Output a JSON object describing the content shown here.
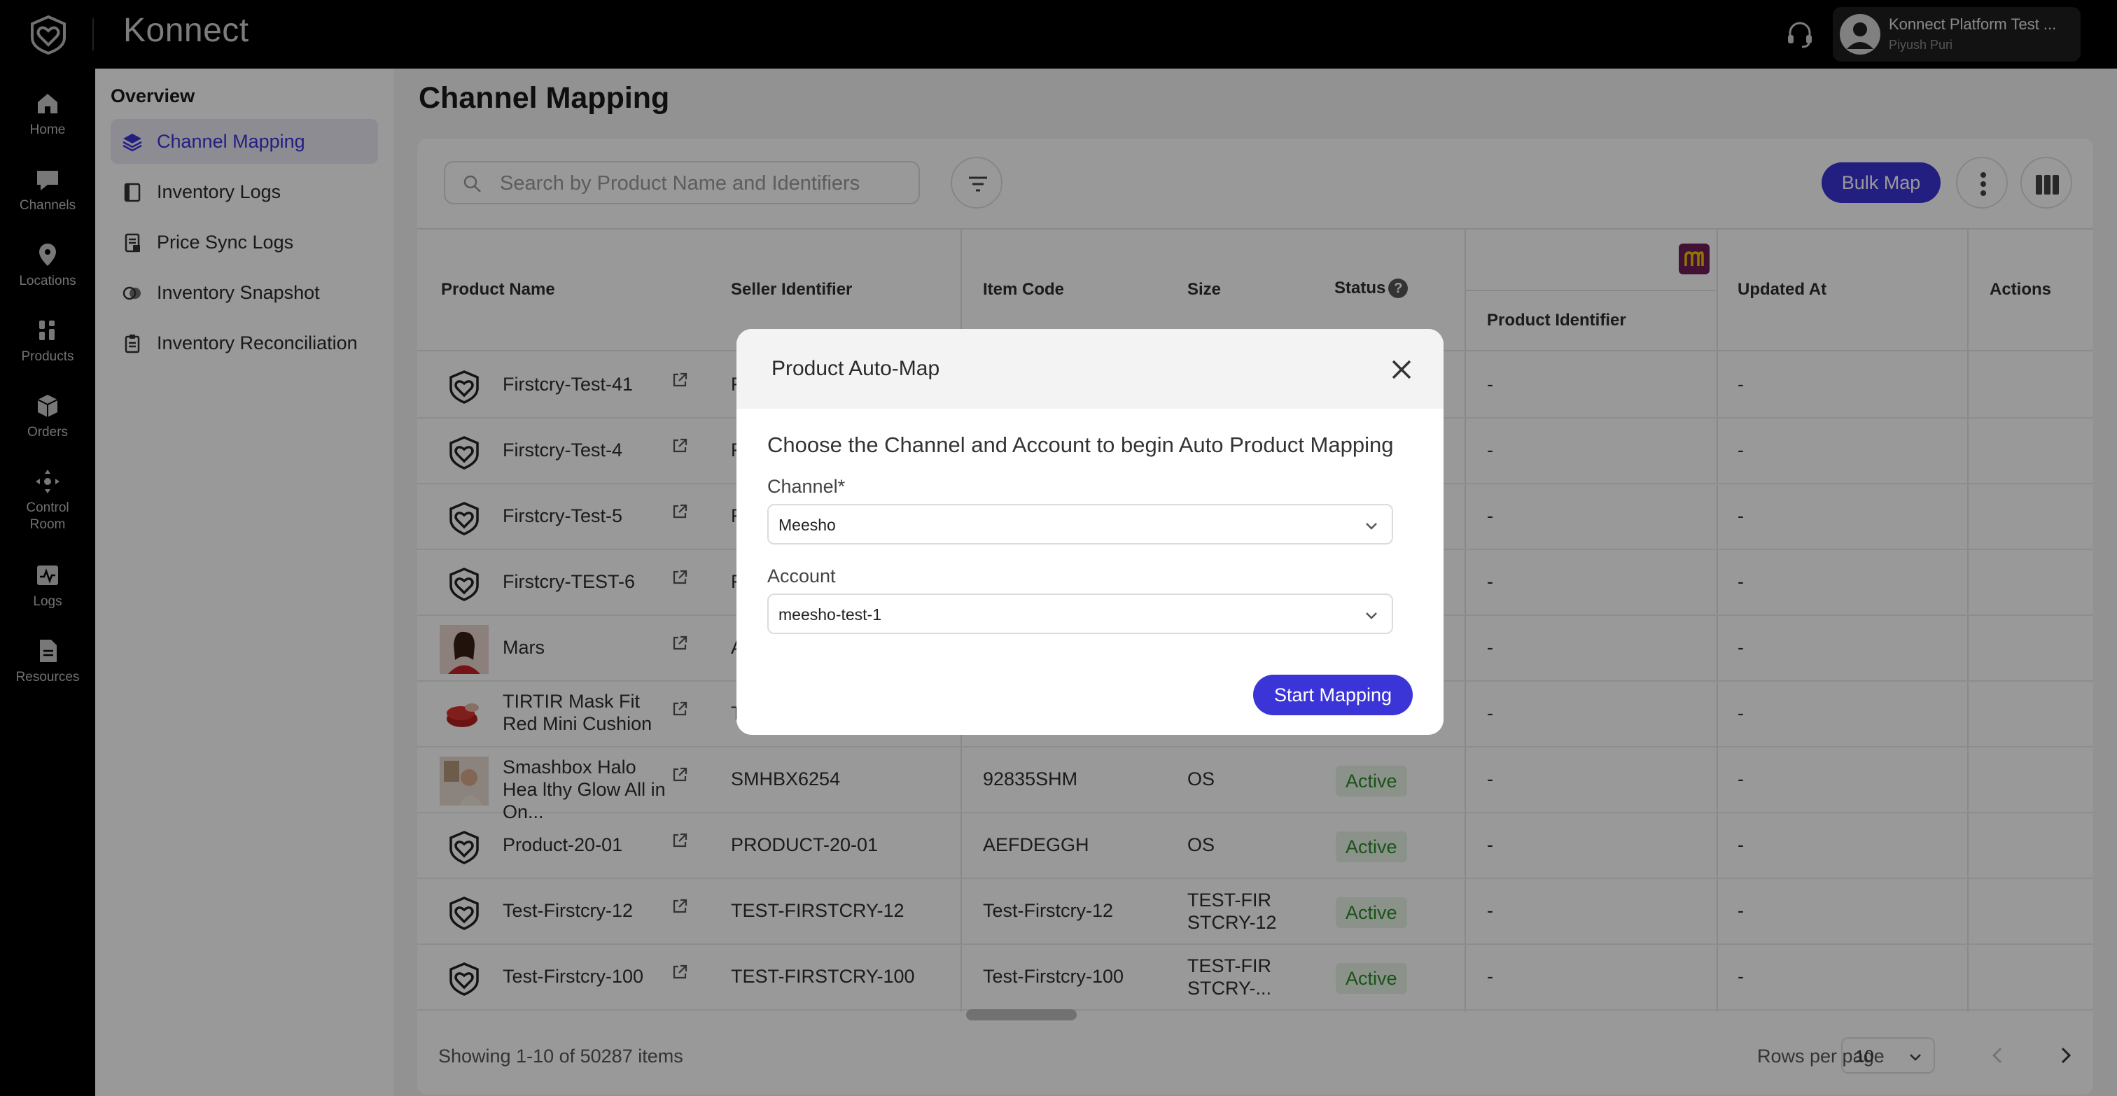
{
  "app": {
    "brand": "Konnect",
    "user_name": "Konnect Platform Test ...",
    "user_sub": "Piyush Puri"
  },
  "rail": {
    "items": [
      {
        "label": "Home",
        "icon": "home-icon"
      },
      {
        "label": "Channels",
        "icon": "channels-icon"
      },
      {
        "label": "Locations",
        "icon": "location-pin-icon"
      },
      {
        "label": "Products",
        "icon": "products-icon"
      },
      {
        "label": "Orders",
        "icon": "orders-box-icon"
      },
      {
        "label": "Control Room",
        "icon": "control-room-icon"
      },
      {
        "label": "Logs",
        "icon": "logs-icon"
      },
      {
        "label": "Resources",
        "icon": "resources-icon"
      }
    ]
  },
  "sidebar": {
    "title": "Overview",
    "items": [
      {
        "label": "Channel Mapping",
        "icon": "layers-icon",
        "active": true
      },
      {
        "label": "Inventory Logs",
        "icon": "book-icon"
      },
      {
        "label": "Price Sync Logs",
        "icon": "receipt-icon"
      },
      {
        "label": "Inventory Snapshot",
        "icon": "snapshot-icon"
      },
      {
        "label": "Inventory Reconciliation",
        "icon": "clipboard-icon"
      }
    ]
  },
  "page": {
    "title": "Channel Mapping",
    "search_placeholder": "Search by Product Name and Identifiers",
    "bulk_map_label": "Bulk Map"
  },
  "table": {
    "headers": {
      "product_name": "Product Name",
      "seller_identifier": "Seller Identifier",
      "item_code": "Item Code",
      "size": "Size",
      "status": "Status",
      "status_help": "?",
      "product_identifier": "Product Identifier",
      "updated_at": "Updated At",
      "actions": "Actions"
    },
    "rows": [
      {
        "name": "Firstcry-Test-41",
        "seller": "F",
        "item": "",
        "size": "",
        "status": "",
        "pid": "-",
        "updated": "-",
        "thumb": "logo"
      },
      {
        "name": "Firstcry-Test-4",
        "seller": "F",
        "item": "",
        "size": "",
        "status": "",
        "pid": "-",
        "updated": "-",
        "thumb": "logo"
      },
      {
        "name": "Firstcry-Test-5",
        "seller": "F",
        "item": "",
        "size": "",
        "status": "",
        "pid": "-",
        "updated": "-",
        "thumb": "logo"
      },
      {
        "name": "Firstcry-TEST-6",
        "seller": "F",
        "item": "",
        "size": "",
        "status": "",
        "pid": "-",
        "updated": "-",
        "thumb": "logo"
      },
      {
        "name": "Mars",
        "seller": "A",
        "item": "",
        "size": "",
        "status": "",
        "pid": "-",
        "updated": "-",
        "thumb": "photo-person"
      },
      {
        "name": "TIRTIR Mask Fit Red Mini Cushion",
        "seller": "T",
        "item": "",
        "size": "",
        "status": "",
        "pid": "-",
        "updated": "-",
        "thumb": "photo-cushion"
      },
      {
        "name": "Smashbox Halo Hea lthy Glow All in On...",
        "seller": "SMHBX6254",
        "item": "92835SHM",
        "size": "OS",
        "status": "Active",
        "pid": "-",
        "updated": "-",
        "thumb": "photo-model"
      },
      {
        "name": "Product-20-01",
        "seller": "PRODUCT-20-01",
        "item": "AEFDEGGH",
        "size": "OS",
        "status": "Active",
        "pid": "-",
        "updated": "-",
        "thumb": "logo"
      },
      {
        "name": "Test-Firstcry-12",
        "seller": "TEST-FIRSTCRY-12",
        "item": "Test-Firstcry-12",
        "size": "TEST-FIR STCRY-12",
        "status": "Active",
        "pid": "-",
        "updated": "-",
        "thumb": "logo"
      },
      {
        "name": "Test-Firstcry-100",
        "seller": "TEST-FIRSTCRY-100",
        "item": "Test-Firstcry-100",
        "size": "TEST-FIR STCRY-...",
        "status": "Active",
        "pid": "-",
        "updated": "-",
        "thumb": "logo"
      }
    ]
  },
  "footer": {
    "showing": "Showing 1-10 of 50287 items",
    "rows_per_page_label": "Rows per page",
    "rows_per_page_value": "10"
  },
  "modal": {
    "title": "Product Auto-Map",
    "description": "Choose the Channel and Account to begin Auto Product Mapping",
    "channel_label": "Channel*",
    "channel_value": "Meesho",
    "account_label": "Account",
    "account_value": "meesho-test-1",
    "start_label": "Start Mapping"
  },
  "colors": {
    "accent": "#3b35d8",
    "status_green": "#2c8a2c",
    "meesho_brand": "#6d1e58"
  }
}
